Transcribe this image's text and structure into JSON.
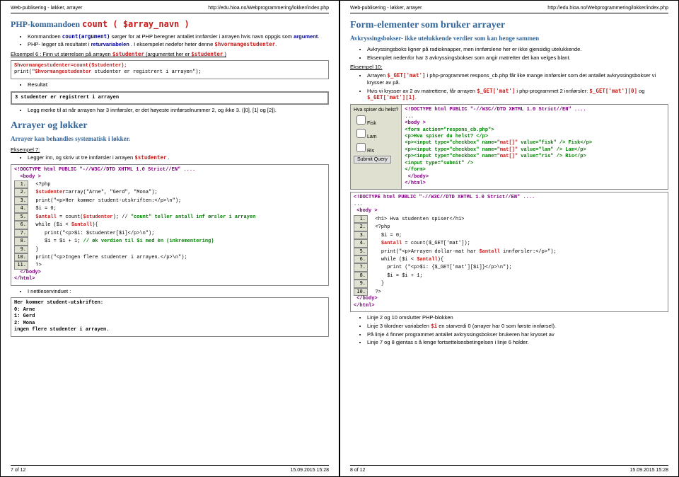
{
  "header": {
    "title": "Web-publisering - løkker, arrayer",
    "url": "http://edu.hioa.no/Webprogrammering/lokker/index.php"
  },
  "footer": {
    "left7": "7 of 12",
    "left8": "8 of 12",
    "time": "15.09.2015 15:28"
  },
  "p7": {
    "sec1": {
      "title": "PHP-kommandoen ",
      "title_code": "count ( $array_navn )",
      "b1a": "Kommandoen ",
      "b1b": "count(argument)",
      "b1c": " sørger for at PHP beregner antallet innførsler i arrayen hvis navn oppgis som ",
      "b1d": "argument",
      "b1e": ".",
      "b2a": "PHP- legger så resultatet i ",
      "b2b": "returvariabelen",
      "b2c": ". I eksempelet nedefor heter denne ",
      "b2d": "$hvormangestudenter",
      "b2e": ".",
      "ex6": "Eksempel 6 : Finn ut størrelsen på arrayen ",
      "ex6b": "$studenter",
      "ex6c": " (argumentet her er ",
      "ex6d": "$studenter",
      "ex6e": ")",
      "code1a": "$hvormangestudenter=count($studenter);",
      "code1b": "print(\"$hvormangestudenter studenter er registrert i arrayen\");",
      "b3": "Resultat:",
      "res": "3 studenter er registrert i arrayen",
      "b4": "Legg merke til at når arrayen har 3 innførsler, er det høyeste innførselnummer 2, og ikke 3. ([0], [1] og [2])."
    },
    "sec2": {
      "title": "Arrayer og løkker",
      "sub": "Arrayer kan behandles systematisk i løkker.",
      "ex7": "Eksempel 7:",
      "b1": "Legger inn, og skriv ut tre innførsler i arrayen ",
      "b1v": "$studenter",
      "b1e": " .",
      "c": {
        "l0": "<!DOCTYPE html PUBLIC \"-//W3C//DTD XHTML 1.0 Strict//EN\" ....",
        "l1": "<body >",
        "n1": "1.",
        "c1": "<?php",
        "n2": "2.",
        "c2a": "$studenter",
        "c2b": "=array(\"Arne\", \"Gerd\", \"Mona\");",
        "n3": "3.",
        "c3": "print(\"<p>Her kommer student-utskriften:</p>\\n\");",
        "n4": "4.",
        "c4": "$i = 0;",
        "n5": "5.",
        "c5a": "$antall",
        "c5b": " = count(",
        "c5c": "$studenter",
        "c5d": "); // ",
        "c5e": "\"count\" teller antall inf ørsler i arrayen",
        "n6": "6.",
        "c6a": "while ($i < ",
        "c6b": "$antall",
        "c6c": "){",
        "n7": "7.",
        "c7": "print(\"<p>$i: $studenter[$i]</p>\\n\");",
        "n8": "8.",
        "c8a": "$i = $i + 1; ",
        "c8b": "// øk verdien til $i med èn (inkrementering)",
        "n9": "9.",
        "c9": "}",
        "n10": "10.",
        "c10": "print(\"<p>Ingen flere studenter i arrayen.</p>\\n\");",
        "n11": "11.",
        "c11": "?>",
        "l12": "</body>",
        "l13": "</html>"
      },
      "b2": "I nettleservinduet :",
      "out": {
        "l1": "Her kommer student-utskriften:",
        "l2": "0: Arne",
        "l3": "1: Gerd",
        "l4": "2: Mona",
        "l5": "ingen flere studenter i arrayen."
      }
    }
  },
  "p8": {
    "title": "Form-elementer som bruker arrayer",
    "sub": "Avkryssingsbokser- ikke utelukkende verdier som kan henge sammen",
    "b1": "Avkryssingsboks ligner på radioknapper, men innførslene her er ikke gjensidig utelukkende.",
    "b2": "Eksemplet nedenfor har 3 avkryssingsbokser som angir matretter det kan velges blant.",
    "ex10": "Eksempel 10:",
    "b3a": "Arrayen ",
    "b3b": "$_GET['mat']",
    "b3c": " i php-programmet respons_cb.php får like mange innførsler som det antallet avkryssingsbokser vi krysser av på.",
    "b4a": "Hvis vi krysser av 2 av matrettene, får arrayen ",
    "b4b": "$_GET['mat']",
    "b4c": " i php-programmet 2 innførsler: ",
    "b4d": "$_GET['mat'][0]",
    "b4e": " og ",
    "b4f": "$_GET['mat'][1]",
    "b4g": ".",
    "form": {
      "q": "Hva spiser du helst?",
      "o1": "Fisk",
      "o2": "Lam",
      "o3": "Ris",
      "submit": "Submit Query"
    },
    "fc": {
      "l0": "<!DOCTYPE html PUBLIC \"-//W3C//DTD XHTML 1.0 Strict//EN\" ....",
      "l0b": "...",
      "l1": "<body >",
      "l2a": "<form action=\"respons_cb.php\">",
      "l2b": "<p>Hva spiser du helst? </p>",
      "l3a": "<p><input type=\"checkbox\" name=",
      "l3b": "\"mat[]\"",
      "l3c": " value=\"fisk\" /> Fisk</p>",
      "l4a": "<p><input type=\"checkbox\" name=",
      "l4b": "\"mat[]\"",
      "l4c": " value=\"lam\" /> Lam</p>",
      "l5a": "<p><input type=\"checkbox\" name=",
      "l5b": "\"mat[]\"",
      "l5c": " value=\"ris\" /> Ris</p>",
      "l6": "<input type=\"submit\" />",
      "l7": "</form>",
      "l8": "</body>",
      "l9": "</html>"
    },
    "rc": {
      "l0": "<!DOCTYPE html PUBLIC \"-//W3C//DTD XHTML 1.0 Strict//EN\" ....",
      "l0b": "...",
      "l1": "<body >",
      "n1": "1.",
      "c1": "<h1> Hva studenten spiser</h1>",
      "n2": "2.",
      "c2": "<?php",
      "n3": "3.",
      "c3": "$i = 0;",
      "n4": "4.",
      "c4a": "$antall",
      "c4b": " = count($_GET['mat']);",
      "n5": "5.",
      "c5a": "print(\"<p>Arrayen dollar-mat har ",
      "c5b": "$antall",
      "c5c": " innførsler:</p>\");",
      "n6": "6.",
      "c6a": "while ($i < ",
      "c6b": "$antall",
      "c6c": "){",
      "n7": "7.",
      "c7": "print (\"<p>$i: {$_GET['mat'][$i]}</p>\\n\");",
      "n8": "8.",
      "c8": "$i = $i + 1;",
      "n9": "9.",
      "c9": "}",
      "n10": "10.",
      "c10": "?>",
      "l11": "</body>",
      "l12": "</html>"
    },
    "bb1": "Linje 2 og 10 omslutter PHP-blokken",
    "bb2a": "Linje 3 tilordner variabelen ",
    "bb2b": "$i",
    "bb2c": " en starverdi 0 (arrayer har 0 som første innførsel).",
    "bb3": "På linje 4 finner programmet antallet avkryssingsbokser brukeren har krysset av",
    "bb4": "Linje 7 og 8 gjentas s å lenge fortsettelsesbetingelsen i linje 6 holder."
  }
}
